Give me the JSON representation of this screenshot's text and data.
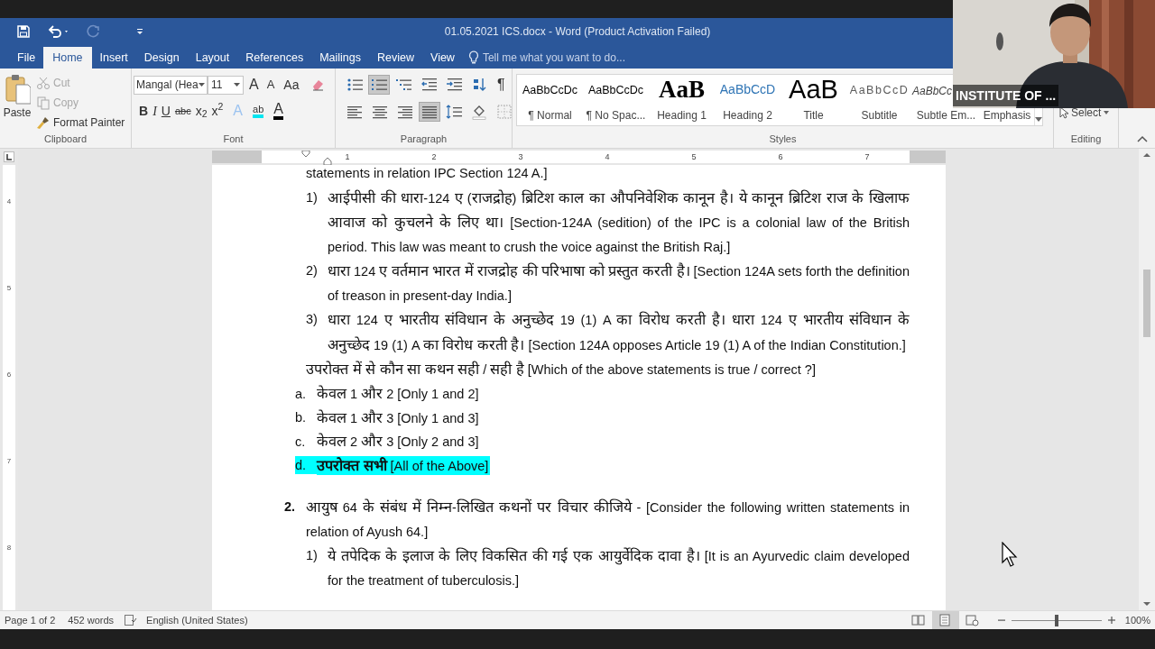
{
  "window": {
    "title": "01.05.2021 ICS.docx - Word (Product Activation Failed)"
  },
  "quick_access": [
    {
      "kind": "save",
      "disabled": false
    },
    {
      "kind": "undo",
      "disabled": false
    },
    {
      "kind": "redo",
      "disabled": true
    },
    {
      "kind": "customize",
      "disabled": false
    }
  ],
  "tabs": [
    {
      "label": "File",
      "selected": false
    },
    {
      "label": "Home",
      "selected": true
    },
    {
      "label": "Insert",
      "selected": false
    },
    {
      "label": "Design",
      "selected": false
    },
    {
      "label": "Layout",
      "selected": false
    },
    {
      "label": "References",
      "selected": false
    },
    {
      "label": "Mailings",
      "selected": false
    },
    {
      "label": "Review",
      "selected": false
    },
    {
      "label": "View",
      "selected": false
    }
  ],
  "tell_me": {
    "placeholder": "Tell me what you want to do..."
  },
  "clipboard": {
    "paste": "Paste",
    "group": "Clipboard",
    "items": [
      {
        "label": "Cut",
        "kind": "cut",
        "disabled": true
      },
      {
        "label": "Copy",
        "kind": "copy",
        "disabled": true
      },
      {
        "label": "Format Painter",
        "kind": "painter",
        "disabled": false
      }
    ]
  },
  "font": {
    "group": "Font",
    "name": "Mangal (Hea",
    "size": "11",
    "row1": [
      {
        "label": "A",
        "kind": "grow"
      },
      {
        "label": "A",
        "kind": "shrink"
      },
      {
        "label": "Aa",
        "kind": "case"
      }
    ],
    "row2": [
      {
        "label": "B",
        "kind": "bold"
      },
      {
        "label": "I",
        "kind": "italic"
      },
      {
        "label": "U",
        "kind": "underline"
      },
      {
        "label": "abc",
        "kind": "strike"
      },
      {
        "label": "x$_{2}$",
        "kind": "sub"
      },
      {
        "label": "x$^{2}$",
        "kind": "sup"
      },
      {
        "label": "A",
        "kind": "effects"
      },
      {
        "label": "ab",
        "kind": "highlight"
      },
      {
        "label": "A",
        "kind": "color"
      }
    ]
  },
  "paragraph": {
    "group": "Paragraph",
    "row1": [
      {
        "kind": "bullets",
        "selected": false
      },
      {
        "kind": "numbering",
        "selected": true
      },
      {
        "kind": "multilevel",
        "selected": false
      },
      {
        "kind": "outdent",
        "selected": false
      },
      {
        "kind": "indent",
        "selected": false
      },
      {
        "kind": "sort",
        "selected": false
      },
      {
        "kind": "marks",
        "label": "¶",
        "selected": false
      }
    ],
    "row2": [
      {
        "kind": "left",
        "selected": false
      },
      {
        "kind": "center",
        "selected": false
      },
      {
        "kind": "right",
        "selected": false
      },
      {
        "kind": "justify",
        "selected": true
      },
      {
        "kind": "spacing",
        "selected": false
      },
      {
        "kind": "shading",
        "selected": false
      },
      {
        "kind": "borders",
        "selected": false
      }
    ]
  },
  "styles": {
    "group": "Styles",
    "items": [
      {
        "kind": "normal",
        "preview": "AaBbCcDc",
        "name": "¶ Normal"
      },
      {
        "kind": "nospacing",
        "preview": "AaBbCcDc",
        "name": "¶ No Spac..."
      },
      {
        "kind": "heading1",
        "preview": "AaB",
        "name": "Heading 1"
      },
      {
        "kind": "heading2",
        "preview": "AaBbCcD",
        "name": "Heading 2"
      },
      {
        "kind": "title",
        "preview": "AaB",
        "name": "Title"
      },
      {
        "kind": "subtitle",
        "preview": "AaBbCcD",
        "name": "Subtitle"
      },
      {
        "kind": "subtle",
        "preview": "AaBbCc",
        "name": "Subtle Em..."
      },
      {
        "kind": "emphasis",
        "name": "Emphasis"
      }
    ]
  },
  "editing": {
    "group": "Editing",
    "select": "Select"
  },
  "ruler": {
    "marks": [
      "1",
      "2",
      "3",
      "4",
      "5",
      "6",
      "7"
    ]
  },
  "vertical_ruler": {
    "marks": [
      "4",
      "5",
      "6",
      "7",
      "8"
    ]
  },
  "document": {
    "blocks": [
      {
        "kind": "text",
        "text": "statements in relation IPC Section 124 A.]"
      },
      {
        "kind": "item",
        "marker": "1)",
        "text": "आईपीसी की धारा-124 ए (राजद्रोह) ब्रिटिश काल का औपनिवेशिक कानून है। ये कानून ब्रिटिश राज के खिलाफ आवाज को कुचलने के लिए था। [Section-124A (sedition) of the IPC is a colonial law of the British period. This law was meant to crush the voice against the British Raj.]"
      },
      {
        "kind": "item",
        "marker": "2)",
        "text": "धारा 124 ए वर्तमान भारत में राजद्रोह की परिभाषा को प्रस्तुत करती है। [Section 124A sets forth the definition of treason in present-day India.]"
      },
      {
        "kind": "item",
        "marker": "3)",
        "text": "धारा 124 ए भारतीय संविधान के अनुच्छेद 19 (1) A का विरोध करती है।  धारा 124 ए भारतीय संविधान के अनुच्छेद 19 (1) A का विरोध करती है। [Section 124A opposes Article 19 (1) A of the Indian Constitution.]"
      },
      {
        "kind": "text",
        "text": "उपरोक्त में से कौन सा कथन सही / सही है [Which of the above statements is true / correct ?]"
      },
      {
        "kind": "option",
        "marker": "a.",
        "text": "केवल 1 और 2 [Only 1 and 2]",
        "selected": false
      },
      {
        "kind": "option",
        "marker": "b.",
        "text": "केवल 1 और 3 [Only 1 and 3]",
        "selected": false
      },
      {
        "kind": "option",
        "marker": "c.",
        "text": "केवल 2 और 3 [Only 2 and 3]",
        "selected": false
      },
      {
        "kind": "option",
        "marker": "d.",
        "text": "**उपरोक्त सभी** [All of the Above]",
        "selected": true
      },
      {
        "kind": "question",
        "marker": "2.",
        "text": "आयुष 64 के संबंध में निम्न-लिखित कथनों पर विचार कीजिये - [Consider the following written statements in relation of Ayush 64.]"
      },
      {
        "kind": "item",
        "marker": "1)",
        "text": "ये तपेदिक के इलाज के लिए विकसित की गई एक आयुर्वेदिक दावा है। [It is an Ayurvedic claim developed for the treatment of tuberculosis.]"
      }
    ]
  },
  "status_bar": {
    "page": "Page 1 of 2",
    "words": "452 words",
    "language": "English (United States)",
    "views": [
      {
        "kind": "read",
        "selected": false
      },
      {
        "kind": "print",
        "selected": true
      },
      {
        "kind": "web",
        "selected": false
      }
    ],
    "zoom": {
      "level": 0.5,
      "reading": "100%"
    }
  },
  "video": {
    "name": "INSTITUTE OF ..."
  }
}
